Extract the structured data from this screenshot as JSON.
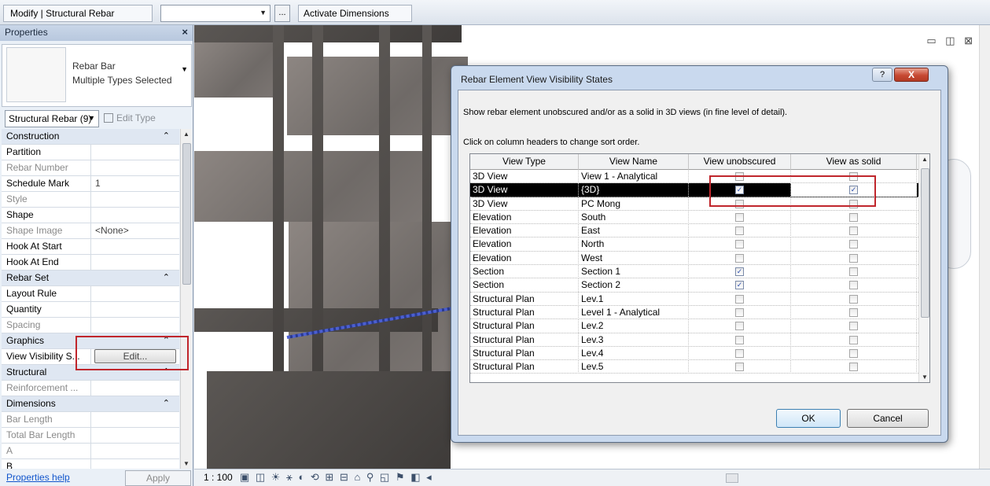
{
  "toolbar": {
    "mode_label": "Modify | Structural Rebar",
    "combo_value": "",
    "ellipsis_label": "...",
    "activate_dimensions_label": "Activate Dimensions"
  },
  "properties": {
    "title": "Properties",
    "close_glyph": "×",
    "type_name_line1": "Rebar Bar",
    "type_name_line2": "Multiple Types Selected",
    "filter_value": "Structural Rebar (9)",
    "edit_type_label": "Edit Type",
    "rows": [
      {
        "name": "Construction",
        "value": "",
        "group": true,
        "chevron": "⌃"
      },
      {
        "name": "Partition",
        "value": ""
      },
      {
        "name": "Rebar Number",
        "value": "",
        "dim": true
      },
      {
        "name": "Schedule Mark",
        "value": "1"
      },
      {
        "name": "Style",
        "value": "",
        "dim": true
      },
      {
        "name": "Shape",
        "value": ""
      },
      {
        "name": "Shape Image",
        "value": "<None>",
        "dim": true
      },
      {
        "name": "Hook At Start",
        "value": ""
      },
      {
        "name": "Hook At End",
        "value": ""
      },
      {
        "name": "Rebar Set",
        "value": "",
        "group": true,
        "chevron": "⌃"
      },
      {
        "name": "Layout Rule",
        "value": ""
      },
      {
        "name": "Quantity",
        "value": ""
      },
      {
        "name": "Spacing",
        "value": "",
        "dim": true
      },
      {
        "name": "Graphics",
        "value": "",
        "group": true,
        "chevron": "⌃"
      },
      {
        "name": "View Visibility S...",
        "value": "",
        "button": "Edit..."
      },
      {
        "name": "Structural",
        "value": "",
        "group": true,
        "chevron": "⌃"
      },
      {
        "name": "Reinforcement ...",
        "value": "",
        "dim": true
      },
      {
        "name": "Dimensions",
        "value": "",
        "group": true,
        "chevron": "⌃"
      },
      {
        "name": "Bar Length",
        "value": "",
        "dim": true
      },
      {
        "name": "Total Bar Length",
        "value": "",
        "dim": true
      },
      {
        "name": "A",
        "value": "",
        "dim": true
      },
      {
        "name": "B",
        "value": ""
      }
    ],
    "help_link": "Properties help",
    "apply_label": "Apply"
  },
  "viewbar": {
    "scale": "1 : 100",
    "icons": "▣ ◫ ☀ ⚹ ◐ ⟲ ⊞ ⊟ ⌂ ⚲ ◱ ⚑ ◧ ◂"
  },
  "view_controls": "▭ ◫ ⊠",
  "dialog": {
    "title": "Rebar Element View Visibility States",
    "help_glyph": "?",
    "close_glyph": "X",
    "description": "Show rebar element unobscured and/or as a solid in 3D views (in fine level of detail).",
    "hint": "Click on column headers to change sort order.",
    "columns": [
      "View Type",
      "View Name",
      "View unobscured",
      "View as solid"
    ],
    "rows": [
      {
        "type": "3D View",
        "name": "View 1 - Analytical",
        "unobscured": false,
        "solid": false
      },
      {
        "type": "3D View",
        "name": "{3D}",
        "unobscured": true,
        "solid": true,
        "selected": true
      },
      {
        "type": "3D View",
        "name": "PC Mong",
        "unobscured": false,
        "solid": false
      },
      {
        "type": "Elevation",
        "name": "South",
        "unobscured": false,
        "solid": false
      },
      {
        "type": "Elevation",
        "name": "East",
        "unobscured": false,
        "solid": false
      },
      {
        "type": "Elevation",
        "name": "North",
        "unobscured": false,
        "solid": false
      },
      {
        "type": "Elevation",
        "name": "West",
        "unobscured": false,
        "solid": false
      },
      {
        "type": "Section",
        "name": "Section 1",
        "unobscured": true,
        "solid": false
      },
      {
        "type": "Section",
        "name": "Section 2",
        "unobscured": true,
        "solid": false
      },
      {
        "type": "Structural Plan",
        "name": "Lev.1",
        "unobscured": false,
        "solid": false
      },
      {
        "type": "Structural Plan",
        "name": "Level 1 - Analytical",
        "unobscured": false,
        "solid": false
      },
      {
        "type": "Structural Plan",
        "name": "Lev.2",
        "unobscured": false,
        "solid": false
      },
      {
        "type": "Structural Plan",
        "name": "Lev.3",
        "unobscured": false,
        "solid": false
      },
      {
        "type": "Structural Plan",
        "name": "Lev.4",
        "unobscured": false,
        "solid": false
      },
      {
        "type": "Structural Plan",
        "name": "Lev.5",
        "unobscured": false,
        "solid": false
      }
    ],
    "ok_label": "OK",
    "cancel_label": "Cancel"
  },
  "colors": {
    "highlight_box": "#c0262c",
    "selected_row": "#000000",
    "link": "#1155cc"
  }
}
